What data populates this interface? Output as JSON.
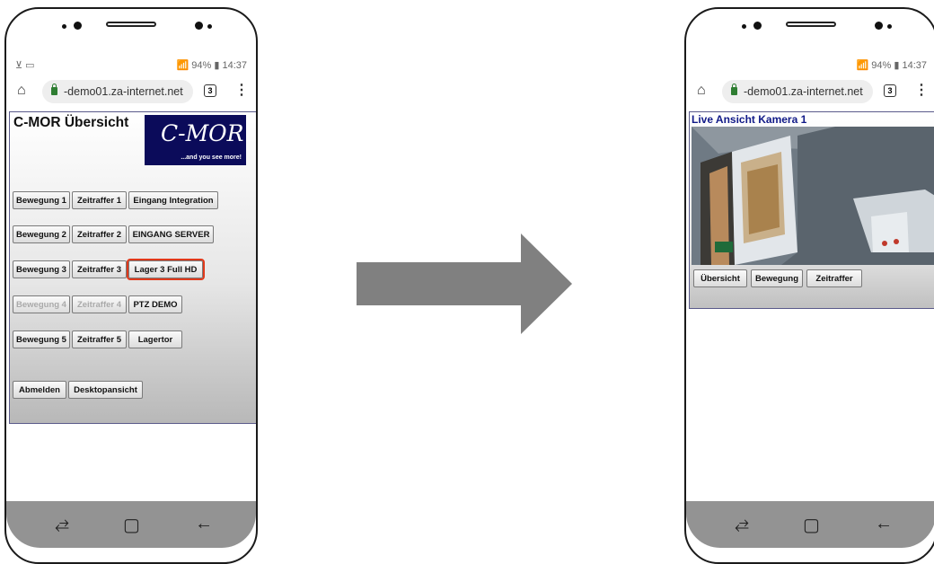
{
  "left_phone": {
    "status": {
      "left": "⊻ ▭",
      "right": "📶 94% ▮ 14:37"
    },
    "url": "-demo01.za-internet.net",
    "tab_count": "3",
    "page_title": "C-MOR Übersicht",
    "logo": {
      "main": "C-MOR",
      "sub": "...and you see more!"
    },
    "rows": [
      [
        "Bewegung 1",
        "Zeitraffer 1",
        "Eingang Integration"
      ],
      [
        "Bewegung 2",
        "Zeitraffer 2",
        "EINGANG SERVER"
      ],
      [
        "Bewegung 3",
        "Zeitraffer 3",
        "Lager 3  Full HD"
      ],
      [
        "Bewegung 4",
        "Zeitraffer 4",
        "PTZ DEMO"
      ],
      [
        "Bewegung 5",
        "Zeitraffer 5",
        "Lagertor"
      ]
    ],
    "bottom_buttons": [
      "Abmelden",
      "Desktopansicht"
    ]
  },
  "right_phone": {
    "status": {
      "right": "📶 94% ▮ 14:37"
    },
    "url": "-demo01.za-internet.net",
    "tab_count": "3",
    "live_title": "Live Ansicht Kamera 1",
    "buttons": [
      "Übersicht",
      "Bewegung",
      "Zeitraffer"
    ]
  },
  "icons": [
    "home-icon",
    "lock-icon",
    "tab-switcher-icon",
    "menu-icon",
    "recent-apps-icon",
    "home-button-icon",
    "back-icon",
    "arrow-right-icon"
  ],
  "colors": {
    "logo_bg": "#0b0b5a",
    "highlight": "#e0391b",
    "live_title": "#111a88",
    "arrow": "#808080"
  }
}
